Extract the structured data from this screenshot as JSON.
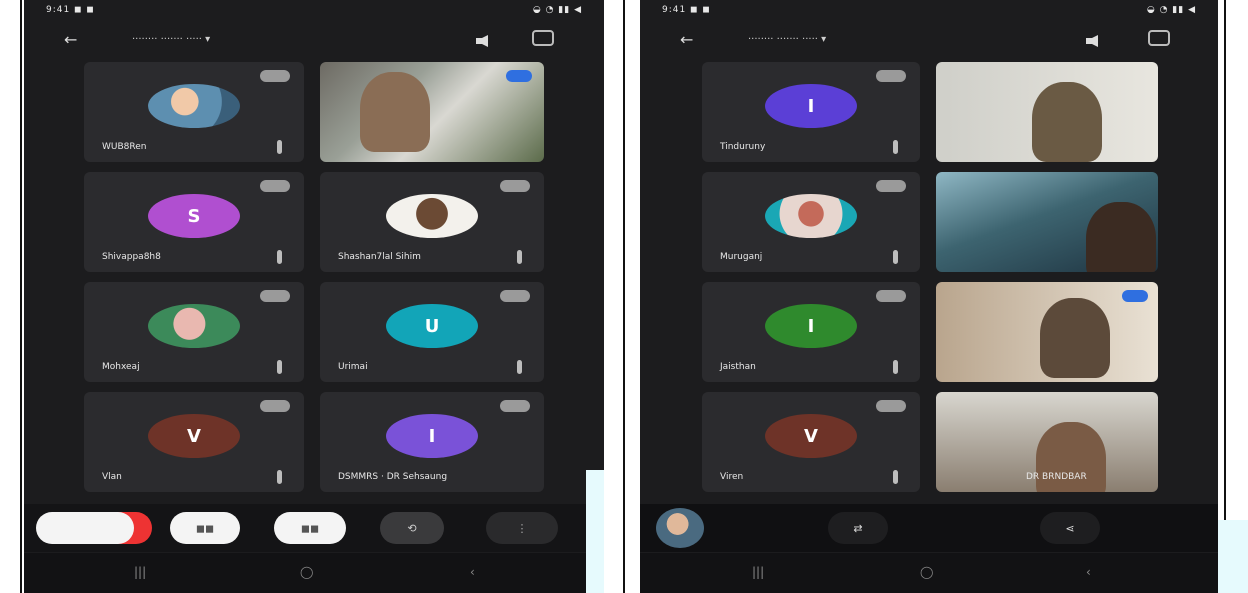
{
  "left_phone": {
    "status": {
      "time": "9:41 ◼ ◼",
      "icons": "◒ ◔ ▮▮ ◀"
    },
    "header": {
      "title": "········ ······· ····· ▾"
    },
    "tiles": [
      {
        "name": "WUB8Ren",
        "avatar_color": "#2b7fb8",
        "avatar_letter": "",
        "photo": true
      },
      {
        "name": "",
        "video": true
      },
      {
        "name": "Shivappa8h8",
        "avatar_color": "#b04fd0",
        "avatar_letter": "S",
        "photo": false
      },
      {
        "name": "Shashan7lal Sihim",
        "avatar_color": "#f0f0f0",
        "avatar_letter": "",
        "photo": true
      },
      {
        "name": "Mohxeaj",
        "avatar_color": "#3c8a5a",
        "avatar_letter": "",
        "photo": true
      },
      {
        "name": "Urimai",
        "avatar_color": "#12a5b8",
        "avatar_letter": "U",
        "photo": false
      },
      {
        "name": "Vlan",
        "avatar_color": "#6e3328",
        "avatar_letter": "V",
        "photo": false
      },
      {
        "name": "DSMMRS · DR Sehsaung",
        "avatar_color": "#7a52d8",
        "avatar_letter": "I",
        "photo": false
      }
    ],
    "controls": [
      "end",
      "mic",
      "cam",
      "switch",
      "more"
    ],
    "nav": [
      "|||",
      "◯",
      "‹"
    ]
  },
  "right_phone": {
    "status": {
      "time": "9:41 ◼ ◼",
      "icons": "◒ ◔ ▮▮ ◀"
    },
    "header": {
      "title": "········ ······· ····· ▾"
    },
    "tiles": [
      {
        "name": "Tinduruny",
        "avatar_color": "#5b3fd6",
        "avatar_letter": "I",
        "photo": false
      },
      {
        "name": "",
        "video": true
      },
      {
        "name": "Muruganj",
        "avatar_color": "#e7d6cf",
        "avatar_letter": "",
        "photo": true
      },
      {
        "name": "",
        "video": true
      },
      {
        "name": "Jaisthan",
        "avatar_color": "#2f8a2d",
        "avatar_letter": "I",
        "photo": false
      },
      {
        "name": "",
        "video": true
      },
      {
        "name": "Viren",
        "avatar_color": "#6e3328",
        "avatar_letter": "V",
        "photo": false
      },
      {
        "name": "DR BRNDBAR",
        "video": true
      }
    ],
    "controls": [
      "self-view",
      "switch",
      "share"
    ],
    "nav": [
      "|||",
      "◯",
      "‹"
    ]
  }
}
